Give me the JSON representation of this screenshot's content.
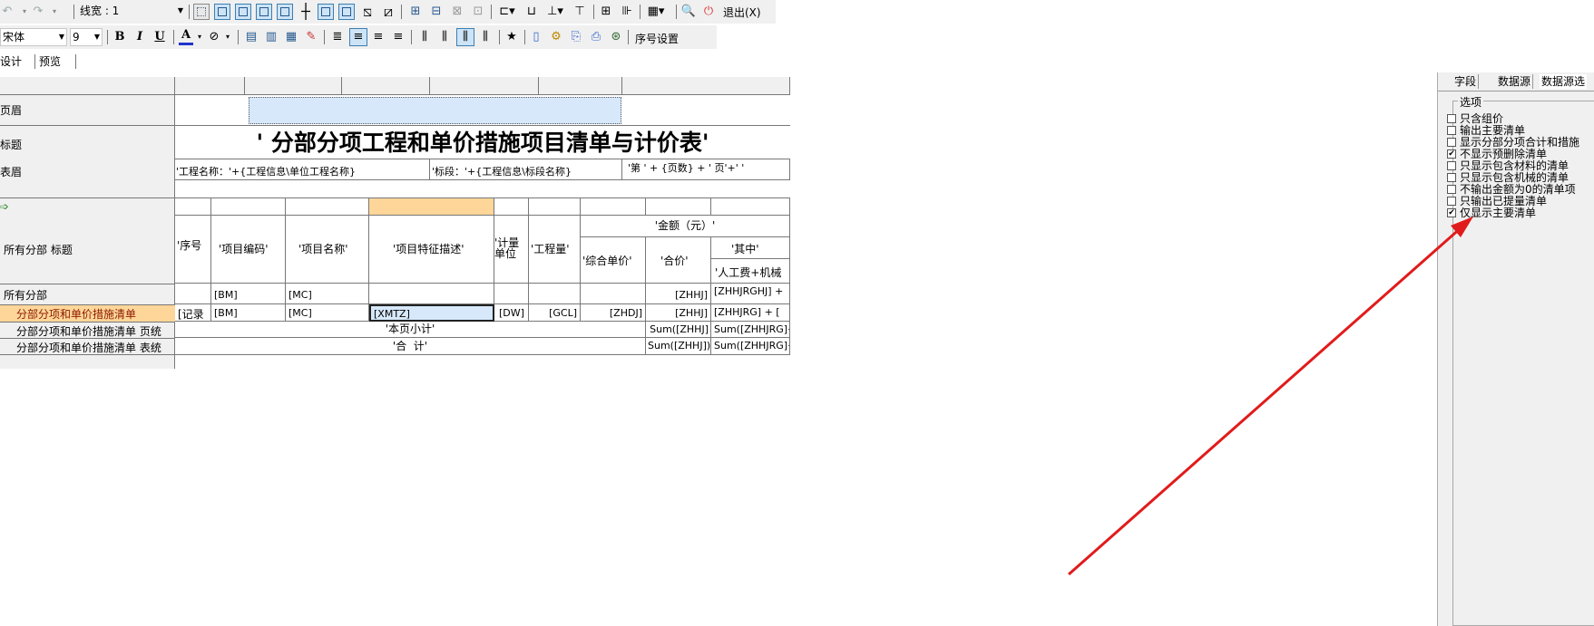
{
  "toolbar1": {
    "line_width_label": "线宽 : 1",
    "exit_label": "退出(X)"
  },
  "toolbar2": {
    "font_name": "宋体",
    "font_size": "9",
    "bold": "B",
    "italic": "I",
    "underline": "U",
    "font_color_glyph": "A",
    "star": "★",
    "serial_setting": "序号设置"
  },
  "tabs": {
    "design": "设计",
    "preview": "预览"
  },
  "report": {
    "row_labels": {
      "page_header": "页眉",
      "title": "标题",
      "table_header": "表眉",
      "all_parts_title": "所有分部 标题",
      "all_parts": "所有分部",
      "detail": "分部分项和单价措施清单",
      "page_footer": "分部分项和单价措施清单 页统",
      "table_footer": "分部分项和单价措施清单 表统"
    },
    "title": "' 分部分项工程和单价措施项目清单与计价表'",
    "header_project": "'工程名称：'+{工程信息\\单位工程名称}",
    "header_section": "'标段：'+{工程信息\\标段名称}",
    "header_page": "'第 ' + {页数} + ' 页'+' '",
    "columns": {
      "seq": "'序号",
      "code": "'项目编码'",
      "name": "'项目名称'",
      "desc": "'项目特征描述'",
      "unit_line1": "'计量",
      "unit_line2": "单位",
      "qty": "'工程量'",
      "amount": "'金额（元）'",
      "unit_price": "'综合单价'",
      "total": "'合价'",
      "among": "'其中'",
      "labor": "'人工费+机械"
    },
    "all_parts_row": {
      "code": "[BM]",
      "name": "[MC]",
      "total": "[ZHHJ]",
      "labor": "[ZHHJRGHJ] +"
    },
    "detail_row": {
      "seq": "[记录",
      "code": "[BM]",
      "name": "[MC]",
      "desc": "[XMTZ]",
      "unit": "[DW]",
      "qty": "[GCL]",
      "unit_price": "[ZHDJ]",
      "total": "[ZHHJ]",
      "labor": "[ZHHJRG] + ["
    },
    "page_footer_row": {
      "label": "'本页小计'",
      "total": "Sum([ZHHJ]",
      "labor": "Sum([ZHHJRG]+"
    },
    "table_footer_row": {
      "label": "'合  计'",
      "total": "Sum([ZHHJ])",
      "labor": "Sum([ZHHJRG]+"
    }
  },
  "right_panel": {
    "tabs": [
      "字段",
      "数据源",
      "数据源选"
    ],
    "group_title": "选项",
    "options": [
      {
        "label": "只含组价",
        "checked": false
      },
      {
        "label": "输出主要清单",
        "checked": false
      },
      {
        "label": "显示分部分项合计和措施",
        "checked": false
      },
      {
        "label": "不显示预删除清单",
        "checked": true
      },
      {
        "label": "只显示包含材料的清单",
        "checked": false
      },
      {
        "label": "只显示包含机械的清单",
        "checked": false
      },
      {
        "label": "不输出金额为0的清单项",
        "checked": false
      },
      {
        "label": "只输出已提量清单",
        "checked": false
      },
      {
        "label": "仅显示主要清单",
        "checked": true
      }
    ]
  },
  "colors": {
    "selection": "#d6e8fa",
    "highlight_col": "#ffd699",
    "annotation_arrow": "#e11b1b",
    "toolbar": "#f0f0f0"
  }
}
